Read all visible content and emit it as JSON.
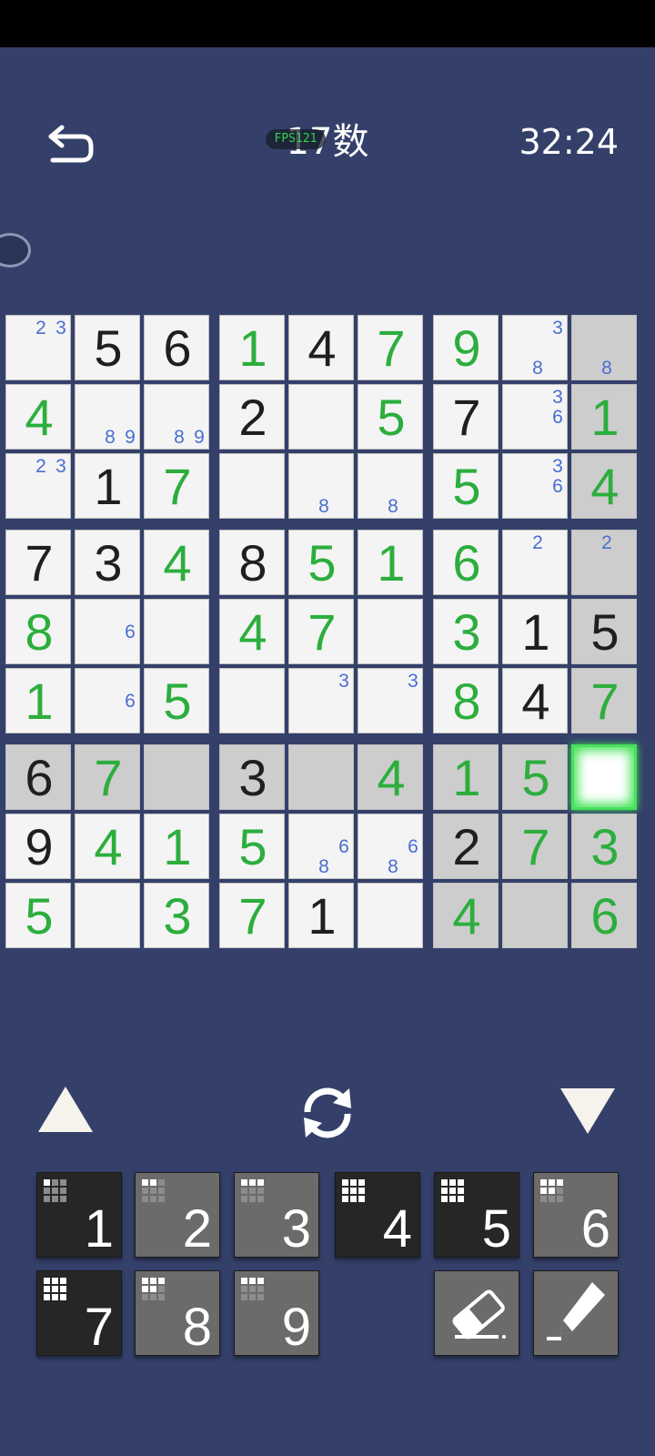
{
  "header": {
    "title": "17数",
    "fps": "FPS121",
    "timer": "32:24",
    "back_icon": "undo-arrow-icon"
  },
  "board": {
    "given_color": "#1f1f1f",
    "user_color": "#2cae3d",
    "note_color": "#4a6fd0",
    "selected": [
      6,
      8
    ],
    "cells": [
      [
        {
          "n": "23"
        },
        {
          "v": "5",
          "g": 1
        },
        {
          "v": "6",
          "g": 1
        },
        {
          "v": "1"
        },
        {
          "v": "4",
          "g": 1
        },
        {
          "v": "7"
        },
        {
          "v": "9"
        },
        {
          "n": "38"
        },
        {
          "n": "8",
          "h": 1
        }
      ],
      [
        {
          "v": "4"
        },
        {
          "n": "89"
        },
        {
          "n": "89"
        },
        {
          "v": "2",
          "g": 1
        },
        {},
        {
          "v": "5"
        },
        {
          "v": "7",
          "g": 1
        },
        {
          "n": "36"
        },
        {
          "v": "1",
          "h": 1
        }
      ],
      [
        {
          "n": "23"
        },
        {
          "v": "1",
          "g": 1
        },
        {
          "v": "7"
        },
        {},
        {
          "n": "8"
        },
        {
          "n": "8"
        },
        {
          "v": "5"
        },
        {
          "n": "36"
        },
        {
          "v": "4",
          "h": 1
        }
      ],
      [
        {
          "v": "7",
          "g": 1
        },
        {
          "v": "3",
          "g": 1
        },
        {
          "v": "4"
        },
        {
          "v": "8",
          "g": 1
        },
        {
          "v": "5"
        },
        {
          "v": "1"
        },
        {
          "v": "6"
        },
        {
          "n": "2"
        },
        {
          "n": "2",
          "h": 1
        }
      ],
      [
        {
          "v": "8"
        },
        {
          "n": "6"
        },
        {},
        {
          "v": "4"
        },
        {
          "v": "7"
        },
        {},
        {
          "v": "3"
        },
        {
          "v": "1",
          "g": 1
        },
        {
          "v": "5",
          "g": 1,
          "h": 1
        }
      ],
      [
        {
          "v": "1"
        },
        {
          "n": "6"
        },
        {
          "v": "5"
        },
        {},
        {
          "n": "3"
        },
        {
          "n": "3"
        },
        {
          "v": "8"
        },
        {
          "v": "4",
          "g": 1
        },
        {
          "v": "7",
          "h": 1
        }
      ],
      [
        {
          "v": "6",
          "g": 1,
          "h": 1
        },
        {
          "v": "7",
          "h": 1
        },
        {
          "h": 1
        },
        {
          "v": "3",
          "g": 1,
          "h": 1
        },
        {
          "h": 1
        },
        {
          "v": "4",
          "h": 1
        },
        {
          "v": "1",
          "h": 1
        },
        {
          "v": "5",
          "h": 1
        },
        {
          "sel": 1
        }
      ],
      [
        {
          "v": "9",
          "g": 1
        },
        {
          "v": "4"
        },
        {
          "v": "1"
        },
        {
          "v": "5"
        },
        {
          "n": "68"
        },
        {
          "n": "68"
        },
        {
          "v": "2",
          "g": 1,
          "h": 1
        },
        {
          "v": "7",
          "h": 1
        },
        {
          "v": "3",
          "h": 1
        }
      ],
      [
        {
          "v": "5"
        },
        {},
        {
          "v": "3"
        },
        {
          "v": "7"
        },
        {
          "v": "1",
          "g": 1
        },
        {},
        {
          "v": "4",
          "h": 1
        },
        {
          "h": 1
        },
        {
          "v": "6",
          "h": 1
        }
      ]
    ]
  },
  "controls": {
    "up_icon": "triangle-up-icon",
    "rotate_icon": "rotate-icon",
    "down_icon": "triangle-down-icon"
  },
  "keypad": {
    "keys": [
      {
        "label": "1",
        "style": "dark",
        "placed": 1
      },
      {
        "label": "2",
        "style": "gray",
        "placed": 2
      },
      {
        "label": "3",
        "style": "gray",
        "placed": 3
      },
      {
        "label": "4",
        "style": "dark",
        "placed": 9
      },
      {
        "label": "5",
        "style": "dark",
        "placed": 9
      },
      {
        "label": "6",
        "style": "gray",
        "placed": 5
      },
      {
        "label": "7",
        "style": "dark",
        "placed": 9
      },
      {
        "label": "8",
        "style": "gray",
        "placed": 5
      },
      {
        "label": "9",
        "style": "gray",
        "placed": 3
      }
    ],
    "erase_icon": "eraser-icon",
    "pencil_icon": "pencil-icon"
  }
}
